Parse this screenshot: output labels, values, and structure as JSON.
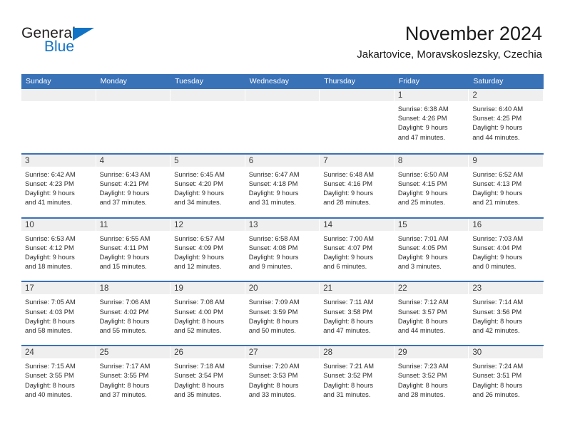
{
  "brand": {
    "name_part1": "General",
    "name_part2": "Blue"
  },
  "header": {
    "title": "November 2024",
    "subtitle": "Jakartovice, Moravskoslezsky, Czechia"
  },
  "colors": {
    "header_blue": "#3a72b8",
    "brand_blue": "#1273c4",
    "day_band_gray": "#efefef",
    "text": "#2b2b2b"
  },
  "weekdays": [
    "Sunday",
    "Monday",
    "Tuesday",
    "Wednesday",
    "Thursday",
    "Friday",
    "Saturday"
  ],
  "weeks": [
    [
      {
        "day": "",
        "lines": []
      },
      {
        "day": "",
        "lines": []
      },
      {
        "day": "",
        "lines": []
      },
      {
        "day": "",
        "lines": []
      },
      {
        "day": "",
        "lines": []
      },
      {
        "day": "1",
        "lines": [
          "Sunrise: 6:38 AM",
          "Sunset: 4:26 PM",
          "Daylight: 9 hours",
          "and 47 minutes."
        ]
      },
      {
        "day": "2",
        "lines": [
          "Sunrise: 6:40 AM",
          "Sunset: 4:25 PM",
          "Daylight: 9 hours",
          "and 44 minutes."
        ]
      }
    ],
    [
      {
        "day": "3",
        "lines": [
          "Sunrise: 6:42 AM",
          "Sunset: 4:23 PM",
          "Daylight: 9 hours",
          "and 41 minutes."
        ]
      },
      {
        "day": "4",
        "lines": [
          "Sunrise: 6:43 AM",
          "Sunset: 4:21 PM",
          "Daylight: 9 hours",
          "and 37 minutes."
        ]
      },
      {
        "day": "5",
        "lines": [
          "Sunrise: 6:45 AM",
          "Sunset: 4:20 PM",
          "Daylight: 9 hours",
          "and 34 minutes."
        ]
      },
      {
        "day": "6",
        "lines": [
          "Sunrise: 6:47 AM",
          "Sunset: 4:18 PM",
          "Daylight: 9 hours",
          "and 31 minutes."
        ]
      },
      {
        "day": "7",
        "lines": [
          "Sunrise: 6:48 AM",
          "Sunset: 4:16 PM",
          "Daylight: 9 hours",
          "and 28 minutes."
        ]
      },
      {
        "day": "8",
        "lines": [
          "Sunrise: 6:50 AM",
          "Sunset: 4:15 PM",
          "Daylight: 9 hours",
          "and 25 minutes."
        ]
      },
      {
        "day": "9",
        "lines": [
          "Sunrise: 6:52 AM",
          "Sunset: 4:13 PM",
          "Daylight: 9 hours",
          "and 21 minutes."
        ]
      }
    ],
    [
      {
        "day": "10",
        "lines": [
          "Sunrise: 6:53 AM",
          "Sunset: 4:12 PM",
          "Daylight: 9 hours",
          "and 18 minutes."
        ]
      },
      {
        "day": "11",
        "lines": [
          "Sunrise: 6:55 AM",
          "Sunset: 4:11 PM",
          "Daylight: 9 hours",
          "and 15 minutes."
        ]
      },
      {
        "day": "12",
        "lines": [
          "Sunrise: 6:57 AM",
          "Sunset: 4:09 PM",
          "Daylight: 9 hours",
          "and 12 minutes."
        ]
      },
      {
        "day": "13",
        "lines": [
          "Sunrise: 6:58 AM",
          "Sunset: 4:08 PM",
          "Daylight: 9 hours",
          "and 9 minutes."
        ]
      },
      {
        "day": "14",
        "lines": [
          "Sunrise: 7:00 AM",
          "Sunset: 4:07 PM",
          "Daylight: 9 hours",
          "and 6 minutes."
        ]
      },
      {
        "day": "15",
        "lines": [
          "Sunrise: 7:01 AM",
          "Sunset: 4:05 PM",
          "Daylight: 9 hours",
          "and 3 minutes."
        ]
      },
      {
        "day": "16",
        "lines": [
          "Sunrise: 7:03 AM",
          "Sunset: 4:04 PM",
          "Daylight: 9 hours",
          "and 0 minutes."
        ]
      }
    ],
    [
      {
        "day": "17",
        "lines": [
          "Sunrise: 7:05 AM",
          "Sunset: 4:03 PM",
          "Daylight: 8 hours",
          "and 58 minutes."
        ]
      },
      {
        "day": "18",
        "lines": [
          "Sunrise: 7:06 AM",
          "Sunset: 4:02 PM",
          "Daylight: 8 hours",
          "and 55 minutes."
        ]
      },
      {
        "day": "19",
        "lines": [
          "Sunrise: 7:08 AM",
          "Sunset: 4:00 PM",
          "Daylight: 8 hours",
          "and 52 minutes."
        ]
      },
      {
        "day": "20",
        "lines": [
          "Sunrise: 7:09 AM",
          "Sunset: 3:59 PM",
          "Daylight: 8 hours",
          "and 50 minutes."
        ]
      },
      {
        "day": "21",
        "lines": [
          "Sunrise: 7:11 AM",
          "Sunset: 3:58 PM",
          "Daylight: 8 hours",
          "and 47 minutes."
        ]
      },
      {
        "day": "22",
        "lines": [
          "Sunrise: 7:12 AM",
          "Sunset: 3:57 PM",
          "Daylight: 8 hours",
          "and 44 minutes."
        ]
      },
      {
        "day": "23",
        "lines": [
          "Sunrise: 7:14 AM",
          "Sunset: 3:56 PM",
          "Daylight: 8 hours",
          "and 42 minutes."
        ]
      }
    ],
    [
      {
        "day": "24",
        "lines": [
          "Sunrise: 7:15 AM",
          "Sunset: 3:55 PM",
          "Daylight: 8 hours",
          "and 40 minutes."
        ]
      },
      {
        "day": "25",
        "lines": [
          "Sunrise: 7:17 AM",
          "Sunset: 3:55 PM",
          "Daylight: 8 hours",
          "and 37 minutes."
        ]
      },
      {
        "day": "26",
        "lines": [
          "Sunrise: 7:18 AM",
          "Sunset: 3:54 PM",
          "Daylight: 8 hours",
          "and 35 minutes."
        ]
      },
      {
        "day": "27",
        "lines": [
          "Sunrise: 7:20 AM",
          "Sunset: 3:53 PM",
          "Daylight: 8 hours",
          "and 33 minutes."
        ]
      },
      {
        "day": "28",
        "lines": [
          "Sunrise: 7:21 AM",
          "Sunset: 3:52 PM",
          "Daylight: 8 hours",
          "and 31 minutes."
        ]
      },
      {
        "day": "29",
        "lines": [
          "Sunrise: 7:23 AM",
          "Sunset: 3:52 PM",
          "Daylight: 8 hours",
          "and 28 minutes."
        ]
      },
      {
        "day": "30",
        "lines": [
          "Sunrise: 7:24 AM",
          "Sunset: 3:51 PM",
          "Daylight: 8 hours",
          "and 26 minutes."
        ]
      }
    ]
  ]
}
